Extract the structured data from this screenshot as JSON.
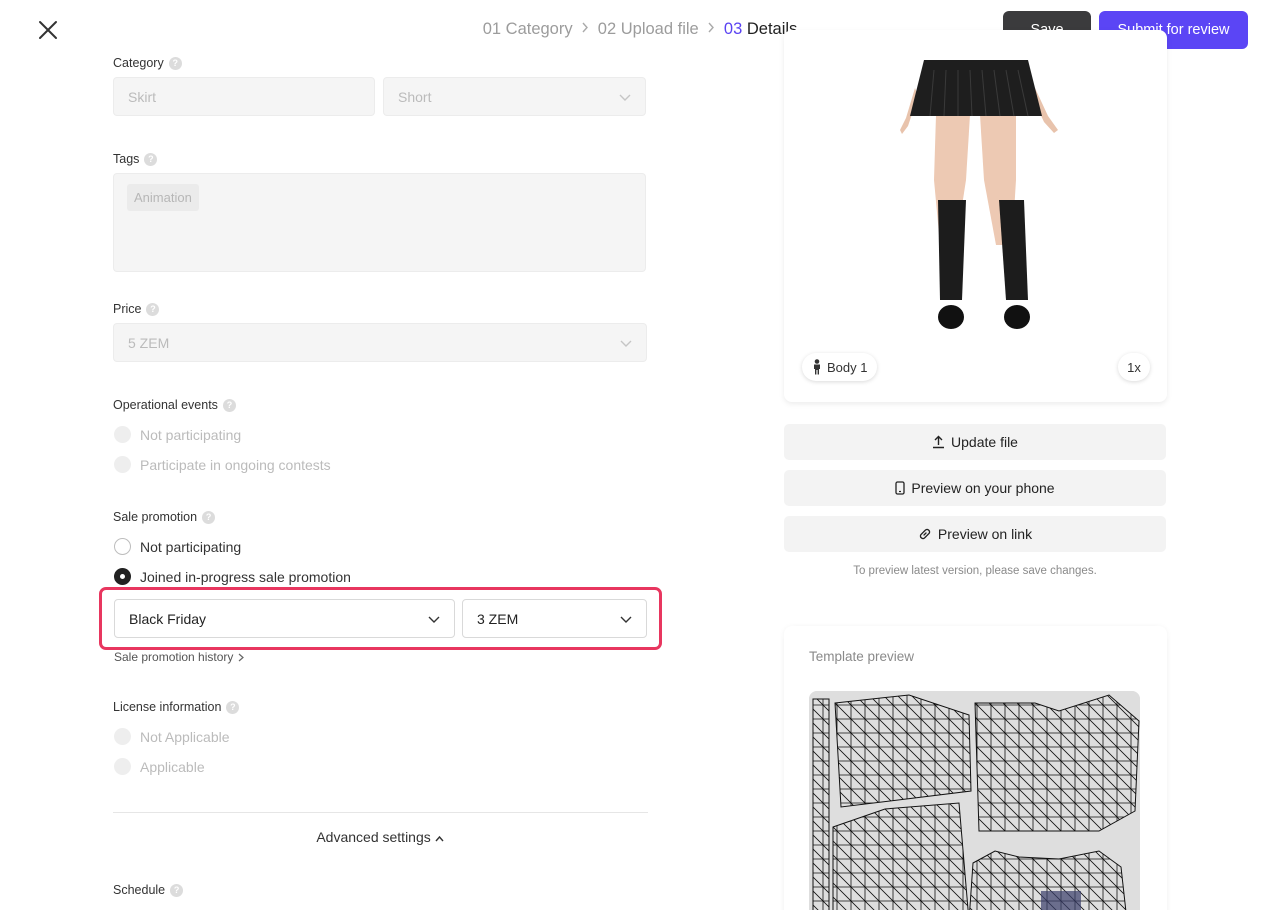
{
  "header": {
    "steps": [
      {
        "num": "01",
        "label": "Category",
        "active": false
      },
      {
        "num": "02",
        "label": "Upload file",
        "active": false
      },
      {
        "num": "03",
        "label": "Details",
        "active": true
      }
    ],
    "save_label": "Save",
    "submit_label": "Submit for review"
  },
  "form": {
    "category": {
      "label": "Category",
      "value1": "Skirt",
      "value2": "Short"
    },
    "tags": {
      "label": "Tags",
      "chip": "Animation"
    },
    "price": {
      "label": "Price",
      "value": "5 ZEM"
    },
    "operational_events": {
      "label": "Operational events",
      "options": [
        "Not participating",
        "Participate in ongoing contests"
      ]
    },
    "sale_promotion": {
      "label": "Sale promotion",
      "options": [
        "Not participating",
        "Joined in-progress sale promotion"
      ],
      "selected_index": 1,
      "event_value": "Black Friday",
      "price_value": "3 ZEM",
      "history_link": "Sale promotion history"
    },
    "license": {
      "label": "License information",
      "options": [
        "Not Applicable",
        "Applicable"
      ]
    },
    "advanced_settings": "Advanced settings",
    "schedule": {
      "label": "Schedule"
    }
  },
  "preview": {
    "body_label": "Body 1",
    "zoom": "1x",
    "update_file": "Update file",
    "preview_phone": "Preview on your phone",
    "preview_link": "Preview on link",
    "hint": "To preview latest version, please save changes.",
    "template_title": "Template preview"
  },
  "colors": {
    "accent": "#5b45f5",
    "highlight": "#e8365f",
    "save_bg": "#3b3b3d"
  }
}
